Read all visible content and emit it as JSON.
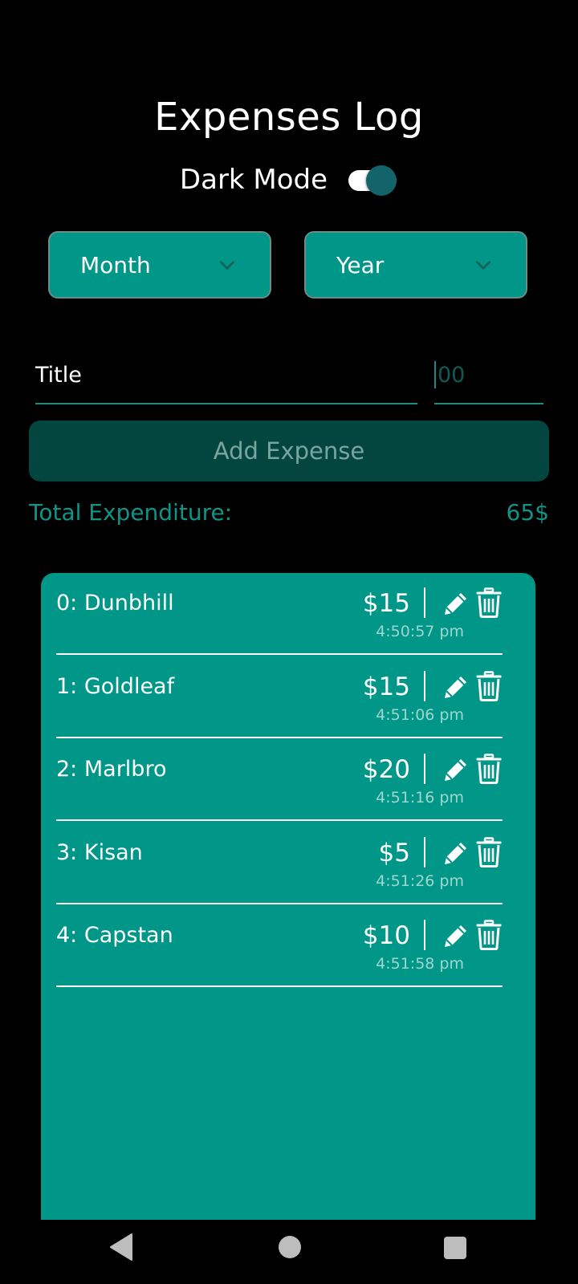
{
  "app": {
    "title": "Expenses Log"
  },
  "dark_mode": {
    "label": "Dark Mode",
    "enabled": true
  },
  "filters": {
    "month": {
      "label": "Month",
      "icon": "chevron-down-icon"
    },
    "year": {
      "label": "Year",
      "icon": "chevron-down-icon"
    }
  },
  "form": {
    "title_value": "Title",
    "amount_placeholder": "00",
    "add_button": "Add Expense"
  },
  "total": {
    "label": "Total Expenditure:",
    "value": "65$"
  },
  "expenses": [
    {
      "name": "0: Dunbhill",
      "amount": "$15",
      "time": "4:50:57 pm"
    },
    {
      "name": "1: Goldleaf",
      "amount": "$15",
      "time": "4:51:06 pm"
    },
    {
      "name": "2: Marlbro",
      "amount": "$20",
      "time": "4:51:16 pm"
    },
    {
      "name": "3: Kisan",
      "amount": "$5",
      "time": "4:51:26 pm"
    },
    {
      "name": "4: Capstan",
      "amount": "$10",
      "time": "4:51:58 pm"
    }
  ],
  "colors": {
    "background": "#000000",
    "accent": "#009688",
    "add_button_bg": "#03453f",
    "toggle_thumb": "#13636b"
  },
  "icons": {
    "edit": "pencil-icon",
    "delete": "trash-icon",
    "nav_back": "back-triangle-icon",
    "nav_home": "home-circle-icon",
    "nav_recent": "recent-square-icon"
  }
}
